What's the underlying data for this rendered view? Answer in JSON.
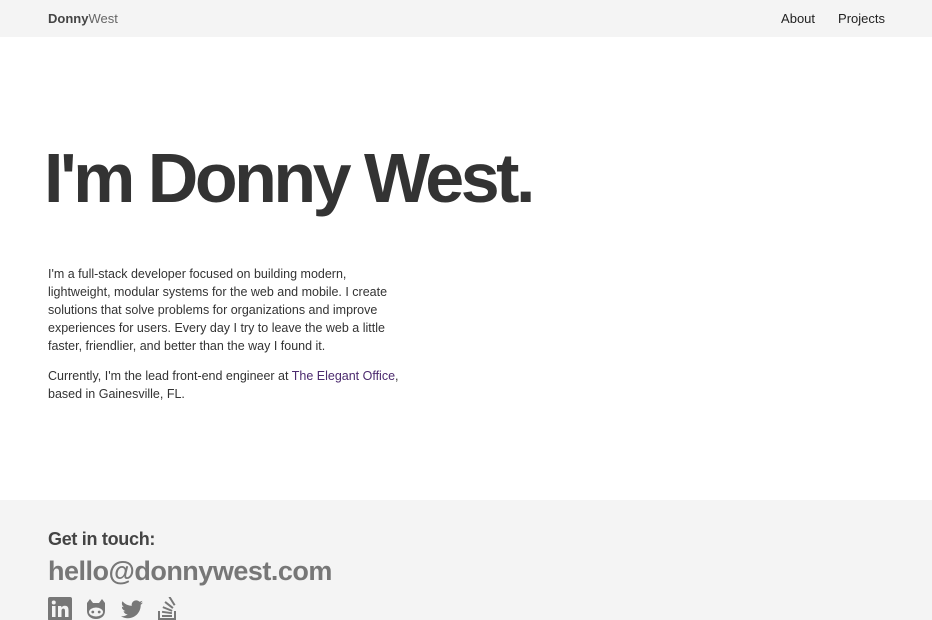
{
  "header": {
    "brand_first": "Donny",
    "brand_last": "West",
    "nav": [
      {
        "label": "About"
      },
      {
        "label": "Projects"
      }
    ]
  },
  "hero": {
    "title": "I'm Donny West."
  },
  "intro": {
    "paragraph1": "I'm a full-stack developer focused on building modern, lightweight, modular systems for the web and mobile. I create solutions that solve problems for organizations and improve experiences for users. Every day I try to leave the web a little faster, friendlier, and better than the way I found it.",
    "paragraph2_before": "Currently, I'm the lead front-end engineer at ",
    "paragraph2_link": "The Elegant Office",
    "paragraph2_after": ", based in Gainesville, FL."
  },
  "footer": {
    "heading": "Get in touch:",
    "email": "hello@donnywest.com",
    "social_icons": [
      "linkedin-icon",
      "github-icon",
      "twitter-icon",
      "stackoverflow-icon"
    ]
  },
  "colors": {
    "topbar_bg": "#f4f4f4",
    "footer_bg": "#f4f4f4",
    "link": "#4b2a6e",
    "heading": "#333333",
    "email": "#777777"
  }
}
